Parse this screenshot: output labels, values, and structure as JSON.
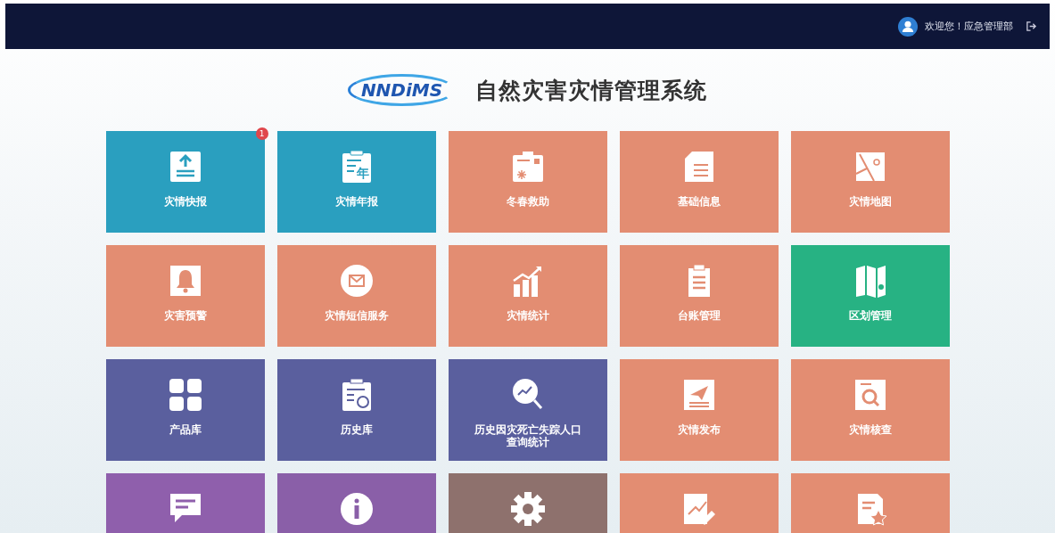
{
  "header": {
    "greeting": "欢迎您！应急管理部"
  },
  "logo": {
    "text": "NNDiMS"
  },
  "title": "自然灾害灾情管理系统",
  "tiles": [
    {
      "label": "灾情快报",
      "color": "#2a9fbf",
      "kind": "upload",
      "badge": "1"
    },
    {
      "label": "灾情年报",
      "color": "#2a9fbf",
      "kind": "yearbook",
      "icon_text": "年"
    },
    {
      "label": "冬春救助",
      "color": "#e38d72",
      "kind": "snow"
    },
    {
      "label": "基础信息",
      "color": "#e38d72",
      "kind": "doc"
    },
    {
      "label": "灾情地图",
      "color": "#e38d72",
      "kind": "map"
    },
    {
      "label": "灾害预警",
      "color": "#e38d72",
      "kind": "bell"
    },
    {
      "label": "灾情短信服务",
      "color": "#e38d72",
      "kind": "mail"
    },
    {
      "label": "灾情统计",
      "color": "#e38d72",
      "kind": "chart"
    },
    {
      "label": "台账管理",
      "color": "#e38d72",
      "kind": "clipboard"
    },
    {
      "label": "区划管理",
      "color": "#27b283",
      "kind": "fold"
    },
    {
      "label": "产品库",
      "color": "#5a5f9e",
      "kind": "grid"
    },
    {
      "label": "历史库",
      "color": "#5a5f9e",
      "kind": "history"
    },
    {
      "label": "历史因灾死亡失踪人口查询统计",
      "color": "#5a5f9e",
      "kind": "trend"
    },
    {
      "label": "灾情发布",
      "color": "#e38d72",
      "kind": "send"
    },
    {
      "label": "灾情核查",
      "color": "#e38d72",
      "kind": "check"
    },
    {
      "color": "#8f5fac",
      "kind": "comment"
    },
    {
      "color": "#8a5fa8",
      "kind": "info"
    },
    {
      "color": "#8e716d",
      "kind": "gear"
    },
    {
      "color": "#e38d72",
      "kind": "edit"
    },
    {
      "color": "#e38d72",
      "kind": "star"
    }
  ]
}
